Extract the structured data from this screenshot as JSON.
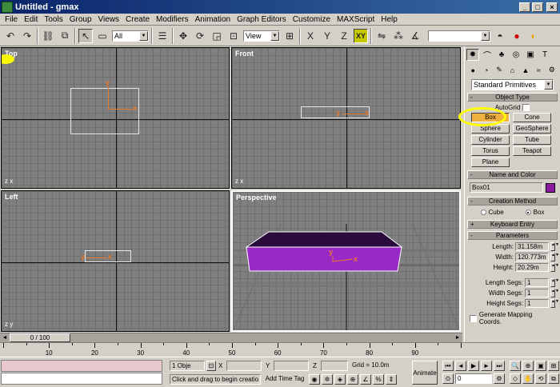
{
  "window": {
    "title": "Untitled - gmax",
    "minimize_label": "_",
    "maximize_label": "□",
    "close_label": "×"
  },
  "menu": [
    "File",
    "Edit",
    "Tools",
    "Group",
    "Views",
    "Create",
    "Modifiers",
    "Animation",
    "Graph Editors",
    "Customize",
    "MAXScript",
    "Help"
  ],
  "toolbar": {
    "selection_filter": "All",
    "reference_coord": "View",
    "constraint_x": "X",
    "constraint_y": "Y",
    "constraint_z": "Z",
    "constraint_xy": "XY",
    "named_selection": ""
  },
  "viewports": {
    "top_label": "Top",
    "front_label": "Front",
    "left_label": "Left",
    "perspective_label": "Perspective",
    "gizmo_x": "x",
    "gizmo_y": "y",
    "corner_axis": "z  x",
    "corner_axis_front": "z  x",
    "corner_axis_left": "z  y"
  },
  "command_panel": {
    "category_dropdown": "Standard Primitives",
    "object_type_title": "Object Type",
    "autogrid_label": "AutoGrid",
    "primitives": [
      "Box",
      "Cone",
      "Sphere",
      "GeoSphere",
      "Cylinder",
      "Tube",
      "Torus",
      "Teapot",
      "Plane"
    ],
    "name_color_title": "Name and Color",
    "object_name": "Box01",
    "object_color": "#8a1aa0",
    "creation_method_title": "Creation Method",
    "method_cube": "Cube",
    "method_box": "Box",
    "keyboard_entry_title": "Keyboard Entry",
    "parameters_title": "Parameters",
    "length_label": "Length:",
    "length_value": "31.158m",
    "width_label": "Width:",
    "width_value": "120.773m",
    "height_label": "Height:",
    "height_value": "20.29m",
    "length_segs_label": "Length Segs:",
    "length_segs_value": "1",
    "width_segs_label": "Width Segs:",
    "width_segs_value": "1",
    "height_segs_label": "Height Segs:",
    "height_segs_value": "1",
    "mapping_label": "Generate Mapping Coords."
  },
  "timeline": {
    "frame_display": "0 / 100",
    "ticks": [
      "10",
      "20",
      "30",
      "40",
      "50",
      "60",
      "70",
      "80",
      "90"
    ]
  },
  "status": {
    "selection_count": "1 Obje",
    "x_label": "X",
    "y_label": "Y",
    "z_label": "Z",
    "grid_text": "Grid = 10.0m",
    "prompt_text": "Click and drag to begin creatio",
    "add_time_tag": "Add Time Tag",
    "animate_label": "Animate",
    "current_frame": "0"
  }
}
